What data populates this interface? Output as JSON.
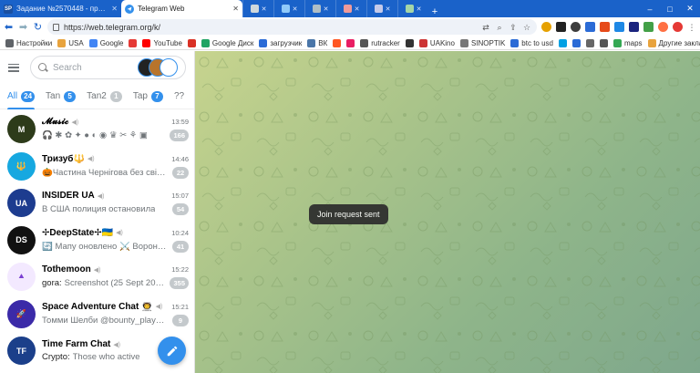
{
  "browser": {
    "tabs": [
      {
        "title": "Задание №2570448 - просмотр з",
        "favicon_color": "#1a4fa0",
        "favicon_text": "SP",
        "active": false
      },
      {
        "title": "Telegram Web",
        "favicon_color": "#3390ec",
        "favicon_text": "",
        "active": true
      }
    ],
    "minitab_count": 6,
    "window_controls": [
      "–",
      "□",
      "✕"
    ],
    "url": "https://web.telegram.org/k/",
    "bookmarks": [
      {
        "label": "Настройки",
        "color": "#5f6368"
      },
      {
        "label": "USA",
        "color": "#e8a33d"
      },
      {
        "label": "Google",
        "color": "#4285f4"
      },
      {
        "label": "",
        "color": "#e53935"
      },
      {
        "label": "YouTube",
        "color": "#ff0000"
      },
      {
        "label": "",
        "color": "#d93025"
      },
      {
        "label": "Google Диск",
        "color": "#1fa463"
      },
      {
        "label": "загрузчик",
        "color": "#2b6bd6"
      },
      {
        "label": "ВК",
        "color": "#4a76a8"
      },
      {
        "label": "",
        "color": "#ff5722"
      },
      {
        "label": "",
        "color": "#e91e63"
      },
      {
        "label": "rutracker",
        "color": "#555555"
      },
      {
        "label": "",
        "color": "#333333"
      },
      {
        "label": "UAKino",
        "color": "#cc3333"
      },
      {
        "label": "SINOPTIK",
        "color": "#777777"
      },
      {
        "label": "btc to usd",
        "color": "#2b6bd6"
      },
      {
        "label": "",
        "color": "#00a0e3"
      },
      {
        "label": "",
        "color": "#2b6bd6"
      },
      {
        "label": "",
        "color": "#666666"
      },
      {
        "label": "",
        "color": "#555555"
      },
      {
        "label": "maps",
        "color": "#34a853"
      },
      {
        "label": "Другие закладки",
        "color": "#e8a33d"
      }
    ]
  },
  "telegram": {
    "search_placeholder": "Search",
    "folders": [
      {
        "label": "All",
        "count": "24",
        "active": true,
        "muted": false
      },
      {
        "label": "Tan",
        "count": "5",
        "active": false,
        "muted": false
      },
      {
        "label": "Tan2",
        "count": "1",
        "active": false,
        "muted": true
      },
      {
        "label": "Tap",
        "count": "7",
        "active": false,
        "muted": false
      },
      {
        "label": "??",
        "count": "",
        "active": false,
        "muted": false
      }
    ],
    "chats": [
      {
        "name": "𝓜𝓾𝓼𝓲𝓬",
        "time": "13:59",
        "sender": "",
        "message": "🎧 ✱ ✿ ✦ ● ◐ ◉ ♛ ✂ ⚘ ▣",
        "unread": "166",
        "avatar_color": "#2d3b1a",
        "avatar_text": "M"
      },
      {
        "name": "Тризуб🔱",
        "time": "14:46",
        "sender": "",
        "message": "🎃Частина Чернігова без світла",
        "unread": "22",
        "avatar_color": "#16a8e0",
        "avatar_text": "🔱"
      },
      {
        "name": "INSIDER UA",
        "time": "15:07",
        "sender": "",
        "message": "В США полиция остановила",
        "unread": "54",
        "avatar_color": "#1d3c8f",
        "avatar_text": "UA"
      },
      {
        "name": "✢DeepState✢🇺🇦",
        "time": "10:24",
        "sender": "",
        "message": "🔄 Мапу оновлено ⚔️ Воронезька",
        "unread": "41",
        "avatar_color": "#111111",
        "avatar_text": "DS"
      },
      {
        "name": "Tothemoon",
        "time": "15:22",
        "sender": "gora:",
        "message": "Screenshot (25 Sept 2023)",
        "unread": "355",
        "avatar_color": "#f3e9ff",
        "avatar_text": "⯅"
      },
      {
        "name": "Space Adventure Chat 👨‍🚀",
        "time": "15:21",
        "sender": "",
        "message": "Томми Шелби @bounty_play🚀: К",
        "unread": "9",
        "avatar_color": "#3b2aa8",
        "avatar_text": "🚀"
      },
      {
        "name": "Time Farm Chat",
        "time": "",
        "sender": "Crypto:",
        "message": "Those who active",
        "unread": "",
        "avatar_color": "#1b3f8a",
        "avatar_text": "TF"
      }
    ],
    "toast": "Join request sent"
  }
}
